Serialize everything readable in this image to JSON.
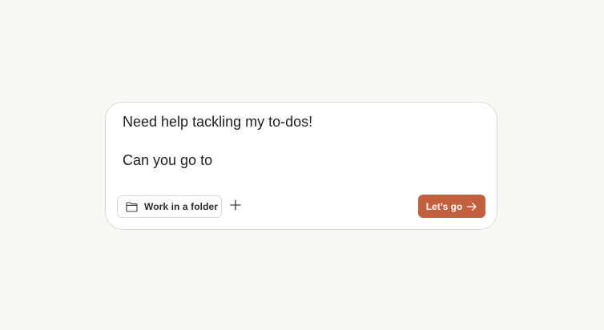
{
  "composer": {
    "prompt_text": "Need help tackling my to-dos!\n\nCan you go to",
    "folder_button_label": "Work in a folder",
    "folder_icon": "folder-icon",
    "add_icon": "plus-icon",
    "submit_label": "Let’s go",
    "submit_icon": "arrow-right-icon"
  },
  "colors": {
    "background": "#f9f8f5",
    "card": "#ffffff",
    "border": "#dcdad4",
    "accent": "#c2603d",
    "text": "#1f1f1e"
  }
}
